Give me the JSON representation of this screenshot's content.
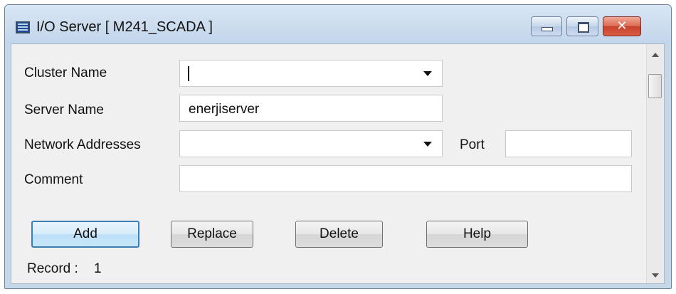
{
  "window": {
    "title": "I/O Server [ M241_SCADA ]",
    "icon": "io-server-app-icon",
    "controls": {
      "minimize": "minimize-icon",
      "maximize": "maximize-icon",
      "close": "close-icon",
      "close_glyph": "✕"
    }
  },
  "form": {
    "cluster_name": {
      "label": "Cluster Name",
      "value": ""
    },
    "server_name": {
      "label": "Server Name",
      "value": "enerjiserver"
    },
    "network_addresses": {
      "label": "Network Addresses",
      "value": ""
    },
    "port": {
      "label": "Port",
      "value": ""
    },
    "comment": {
      "label": "Comment",
      "value": ""
    }
  },
  "buttons": {
    "add": "Add",
    "replace": "Replace",
    "delete": "Delete",
    "help": "Help"
  },
  "record": {
    "label": "Record :",
    "value": "1"
  },
  "colors": {
    "title_bar": "#c6d7ea",
    "close_button": "#c7412a",
    "default_button_border": "#3c7fb1",
    "client_bg": "#f0f0f0"
  }
}
